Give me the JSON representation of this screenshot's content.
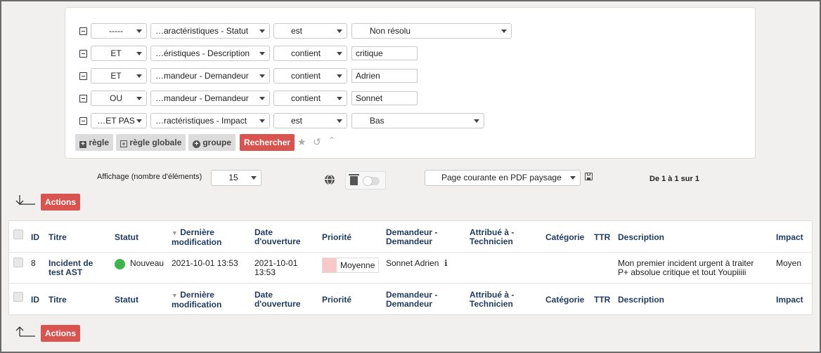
{
  "criteria": [
    {
      "link": "-----",
      "field": "…aractéristiques - Statut",
      "op": "est",
      "value": "Non résolu",
      "value_type": "select"
    },
    {
      "link": "ET",
      "field": "…éristiques - Description",
      "op": "contient",
      "value": "critique",
      "value_type": "text"
    },
    {
      "link": "ET",
      "field": "…mandeur - Demandeur",
      "op": "contient",
      "value": "Adrien",
      "value_type": "text"
    },
    {
      "link": "OU",
      "field": "…mandeur - Demandeur",
      "op": "contient",
      "value": "Sonnet",
      "value_type": "text"
    },
    {
      "link": "…ET PAS",
      "field": "…ractéristiques - Impact",
      "op": "est",
      "value": "Bas",
      "value_type": "select"
    }
  ],
  "buttons": {
    "rule": "règle",
    "global_rule": "règle globale",
    "group": "groupe",
    "search": "Rechercher"
  },
  "display": {
    "label": "Affichage (nombre d'éléments)",
    "count": "15",
    "export": "Page courante en PDF paysage",
    "pagination": "De 1 à 1 sur 1"
  },
  "actions_label": "Actions",
  "table": {
    "headers": {
      "id": "ID",
      "title": "Titre",
      "status": "Statut",
      "modified_1": "Dernière",
      "modified_2": "modification",
      "opened_1": "Date",
      "opened_2": "d'ouverture",
      "priority": "Priorité",
      "requester_1": "Demandeur -",
      "requester_2": "Demandeur",
      "assigned_1": "Attribué à -",
      "assigned_2": "Technicien",
      "category": "Catégorie",
      "ttr": "TTR",
      "description": "Description",
      "impact": "Impact"
    },
    "row": {
      "id": "8",
      "title_1": "Incident de",
      "title_2": "test AST",
      "status": "Nouveau",
      "modified": "2021-10-01 13:53",
      "opened_1": "2021-10-01",
      "opened_2": "13:53",
      "priority": "Moyenne",
      "requester": "Sonnet Adrien",
      "description_1": "Mon premier incident urgent à traiter",
      "description_2": "P+ absolue critique et tout Youpiiiii",
      "impact": "Moyen"
    }
  },
  "colors": {
    "accent_red": "#d9534f",
    "status_green": "#3cb44b",
    "header_navy": "#1e3a5f",
    "priority_swatch": "#f8c9c9"
  }
}
